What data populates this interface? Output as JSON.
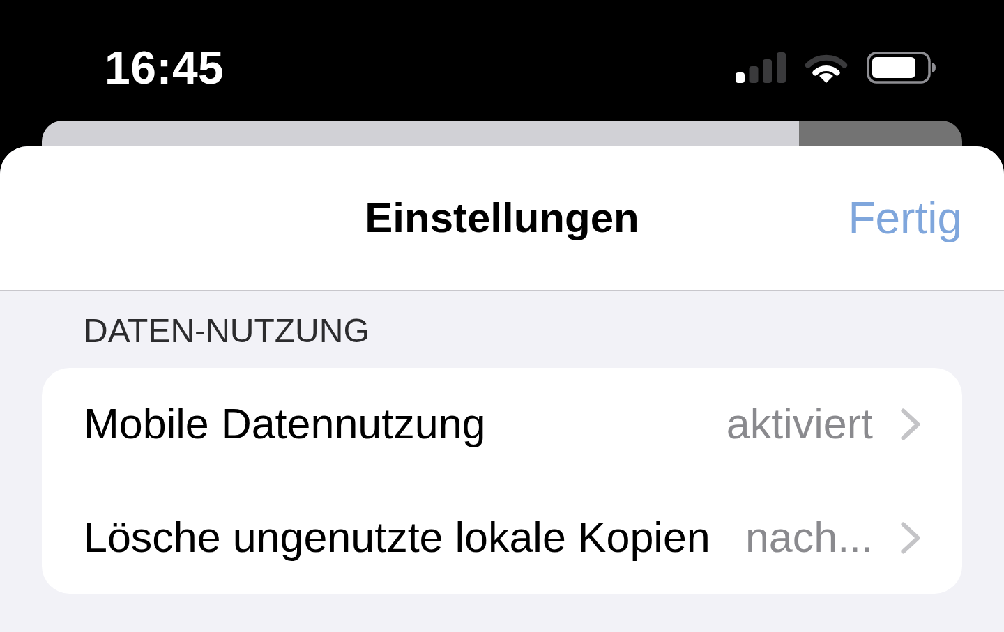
{
  "status_bar": {
    "time": "16:45"
  },
  "navigation_bar": {
    "title": "Einstellungen",
    "done_button": "Fertig"
  },
  "sections": [
    {
      "header": "DATEN-NUTZUNG",
      "rows": [
        {
          "label": "Mobile Datennutzung",
          "value": "aktiviert"
        },
        {
          "label": "Lösche ungenutzte lokale Kopien",
          "value": "nach..."
        }
      ]
    }
  ]
}
